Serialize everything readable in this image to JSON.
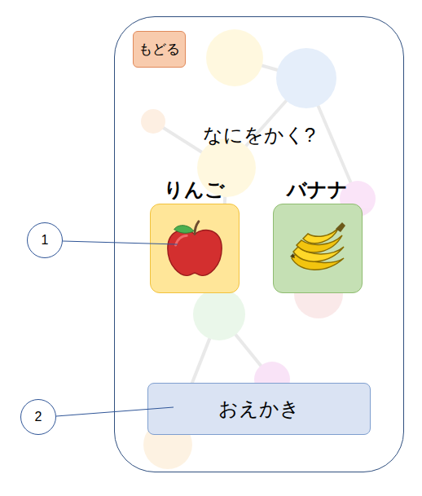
{
  "back_button": {
    "label": "もどる"
  },
  "title": "なにをかく?",
  "choices": [
    {
      "label": "りんご",
      "kind": "apple",
      "color": "#ffe699"
    },
    {
      "label": "バナナ",
      "kind": "banana",
      "color": "#c5e0b4"
    }
  ],
  "draw_button": {
    "label": "おえかき"
  },
  "annotations": [
    {
      "number": "1"
    },
    {
      "number": "2"
    }
  ]
}
